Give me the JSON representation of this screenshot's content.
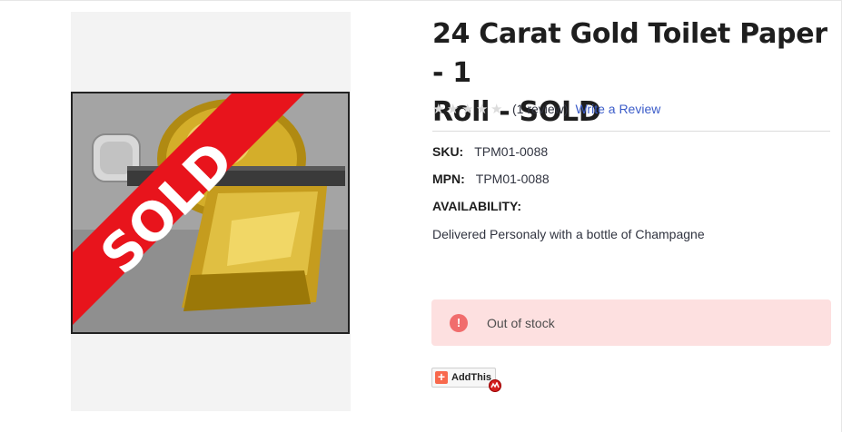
{
  "product": {
    "title_line1": "24 Carat Gold Toilet Paper - 1",
    "title_line2": "Roll - SOLD",
    "image_banner_text": "SOLD"
  },
  "rating": {
    "stars_filled": 0,
    "stars_total": 5,
    "review_count_text": "(1 review)",
    "write_review_label": "Write a Review"
  },
  "specs": {
    "sku_label": "SKU:",
    "sku_value": "TPM01-0088",
    "mpn_label": "MPN:",
    "mpn_value": "TPM01-0088",
    "availability_label": "AVAILABILITY:",
    "availability_desc": "Delivered Personaly with a bottle of Champagne"
  },
  "stock_alert": {
    "icon": "exclamation-icon",
    "icon_glyph": "!",
    "text": "Out of stock"
  },
  "share": {
    "addthis_label": "AddThis",
    "addthis_plus": "+"
  },
  "colors": {
    "alert_bg": "#fde0e0",
    "alert_icon": "#f16d6d",
    "link": "#3b5cc9",
    "sold_banner": "#e8141c"
  }
}
